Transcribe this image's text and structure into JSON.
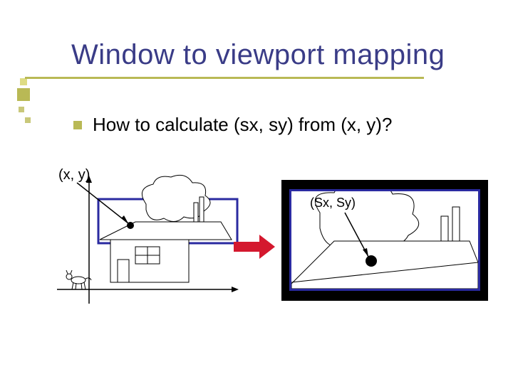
{
  "title": "Window to viewport mapping",
  "bullet": "How to calculate (sx, sy) from (x, y)?",
  "labels": {
    "world_point": "(x, y)",
    "screen_point": "(Sx, Sy)"
  },
  "colors": {
    "title": "#3a3c87",
    "accent": "#b9b955",
    "arrow": "#d4182e",
    "viewport_frame": "#2a2aa0"
  }
}
